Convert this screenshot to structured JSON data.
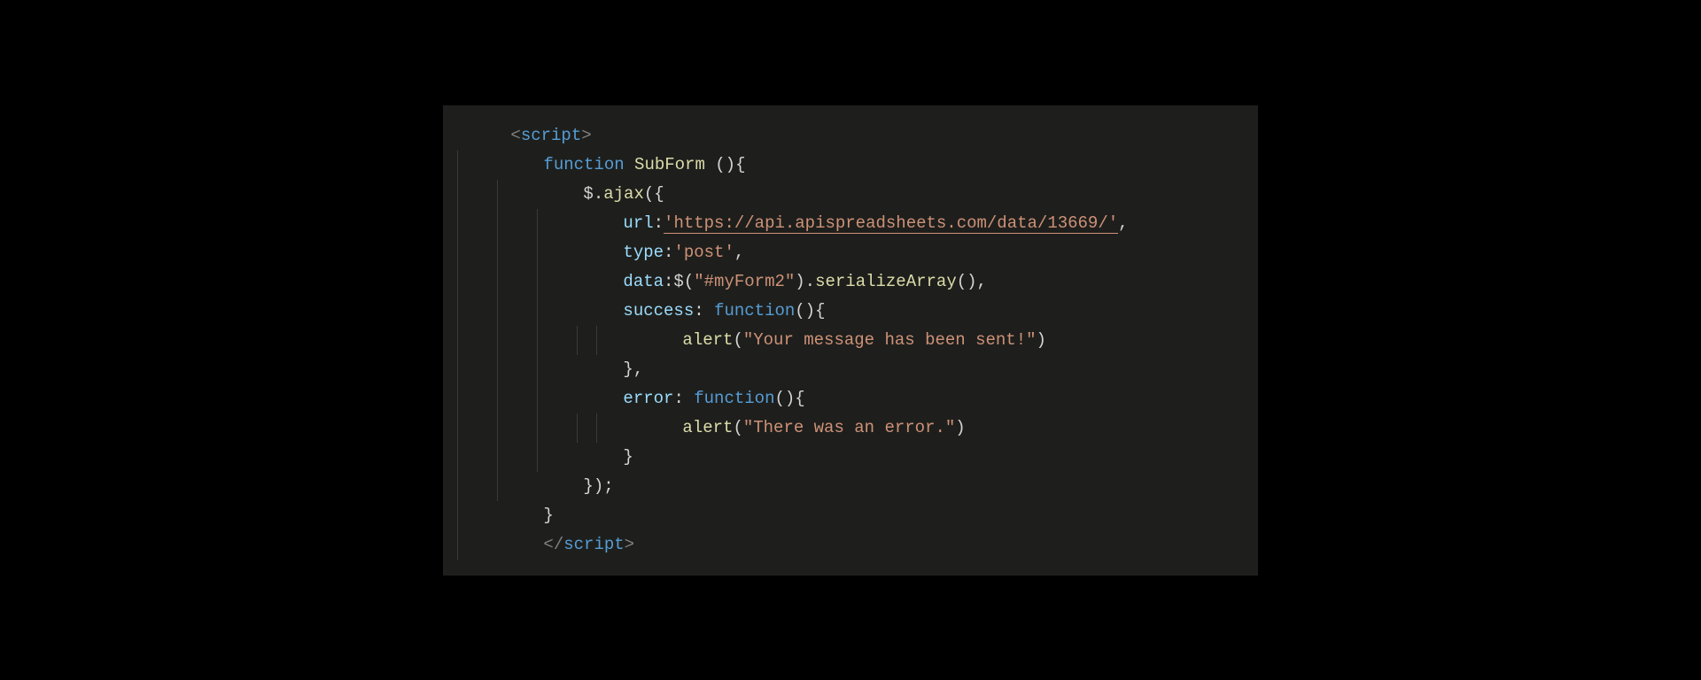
{
  "code": {
    "script_open_bracket_l": "<",
    "script_tag": "script",
    "script_open_bracket_r": ">",
    "kw_function": "function",
    "func_name": "SubForm",
    "func_sig_tail": " (){",
    "ajax_prefix": "$.",
    "ajax_call": "ajax",
    "ajax_open": "({",
    "url_key": "url",
    "colon": ":",
    "url_val": "'https://api.apispreadsheets.com/data/13669/'",
    "comma": ",",
    "type_key": "type",
    "type_val": "'post'",
    "data_key": "data",
    "data_jq": ":$(",
    "data_selector": "\"#myForm2\"",
    "data_tail_paren": ").",
    "serialize": "serializeArray",
    "serialize_tail": "(),",
    "success_key": "success",
    "success_sep": ": ",
    "success_fn_tail": "(){",
    "alert_fn": "alert",
    "alert_open": "(",
    "success_msg": "\"Your message has been sent!\"",
    "alert_close": ")",
    "brace_close_comma": "},",
    "error_key": "error",
    "error_sep": ": ",
    "error_fn_tail": "(){",
    "error_msg": "\"There was an error.\"",
    "brace_close": "}",
    "ajax_close": "});",
    "script_close_bracket_l": "</",
    "script_close_bracket_r": ">"
  }
}
